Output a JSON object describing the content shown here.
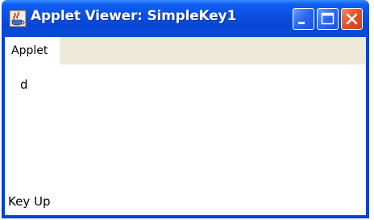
{
  "window": {
    "title": "Applet Viewer: SimpleKey1"
  },
  "icons": {
    "app": "java-coffee-cup-icon",
    "minimize": "minimize-icon",
    "maximize": "maximize-icon",
    "close": "close-icon"
  },
  "menu": {
    "items": [
      {
        "label": "Applet"
      }
    ]
  },
  "applet": {
    "typed_char": "d",
    "status_text": "Key Up"
  },
  "colors": {
    "titlebar": "#0a4fe0",
    "close_button": "#e0522a",
    "menubar": "#ece9d8"
  }
}
